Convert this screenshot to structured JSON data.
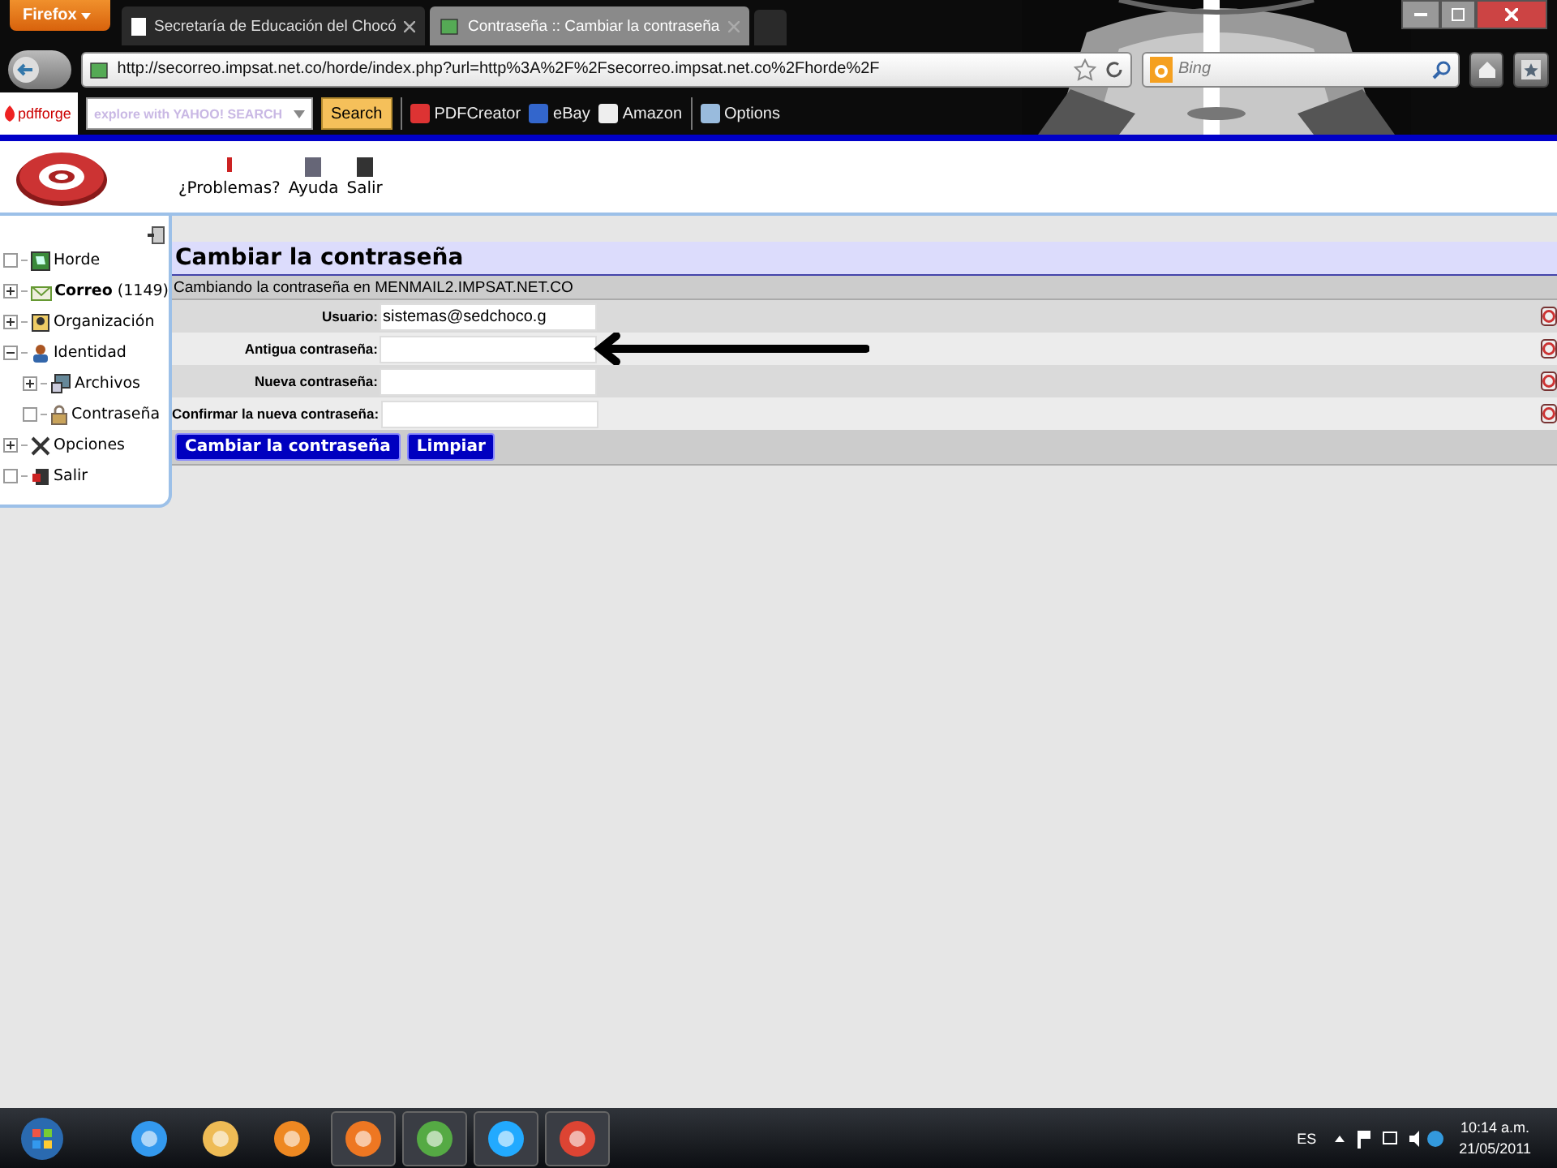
{
  "browser": {
    "menu_button": "Firefox",
    "tabs": [
      {
        "title": "Secretaría de Educación del Chocó",
        "selected": false
      },
      {
        "title": "Contraseña :: Cambiar la contraseña",
        "selected": true
      }
    ],
    "url": "http://secorreo.impsat.net.co/horde/index.php?url=http%3A%2F%2Fsecorreo.impsat.net.co%2Fhorde%2F",
    "search_placeholder": "Bing",
    "toolbar": {
      "logo": "pdfforge",
      "search_placeholder": "explore with YAHOO! SEARCH",
      "search_button": "Search",
      "links": [
        "PDFCreator",
        "eBay",
        "Amazon",
        "Options"
      ]
    }
  },
  "header_menu": [
    "¿Problemas?",
    "Ayuda",
    "Salir"
  ],
  "sidebar": {
    "items": [
      {
        "label": "Horde",
        "selected": false
      },
      {
        "label": "Correo",
        "count": "(1149)",
        "expanded": false,
        "selected": true
      },
      {
        "label": "Organización",
        "expanded": false,
        "selected": false
      },
      {
        "label": "Identidad",
        "expanded": true,
        "selected": false,
        "children": [
          {
            "label": "Archivos",
            "expanded": false,
            "selected": false
          },
          {
            "label": "Contraseña",
            "selected": false
          }
        ]
      },
      {
        "label": "Opciones",
        "expanded": false,
        "selected": false
      },
      {
        "label": "Salir",
        "selected": false
      }
    ]
  },
  "form": {
    "title": "Cambiar la contraseña",
    "subtitle": "Cambiando la contraseña en MENMAIL2.IMPSAT.NET.CO",
    "fields": [
      {
        "label": "Usuario:",
        "value": "sistemas@sedchoco.g"
      },
      {
        "label": "Antigua contraseña:"
      },
      {
        "label": "Nueva contraseña:"
      },
      {
        "label": "Confirmar la nueva contraseña:"
      }
    ],
    "buttons": [
      "Cambiar la contraseña",
      "Limpiar"
    ]
  },
  "taskbar": {
    "language": "ES",
    "time": "10:14 a.m.",
    "date": "21/05/2011"
  }
}
